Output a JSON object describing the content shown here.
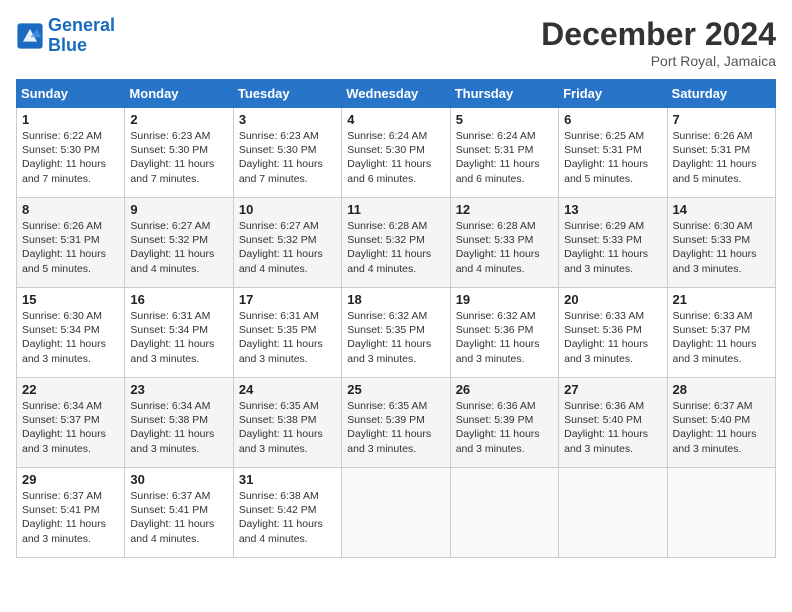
{
  "header": {
    "logo_general": "General",
    "logo_blue": "Blue",
    "month_title": "December 2024",
    "location": "Port Royal, Jamaica"
  },
  "weekdays": [
    "Sunday",
    "Monday",
    "Tuesday",
    "Wednesday",
    "Thursday",
    "Friday",
    "Saturday"
  ],
  "weeks": [
    [
      {
        "day": 1,
        "sunrise": "6:22 AM",
        "sunset": "5:30 PM",
        "daylight": "11 hours and 7 minutes."
      },
      {
        "day": 2,
        "sunrise": "6:23 AM",
        "sunset": "5:30 PM",
        "daylight": "11 hours and 7 minutes."
      },
      {
        "day": 3,
        "sunrise": "6:23 AM",
        "sunset": "5:30 PM",
        "daylight": "11 hours and 7 minutes."
      },
      {
        "day": 4,
        "sunrise": "6:24 AM",
        "sunset": "5:30 PM",
        "daylight": "11 hours and 6 minutes."
      },
      {
        "day": 5,
        "sunrise": "6:24 AM",
        "sunset": "5:31 PM",
        "daylight": "11 hours and 6 minutes."
      },
      {
        "day": 6,
        "sunrise": "6:25 AM",
        "sunset": "5:31 PM",
        "daylight": "11 hours and 5 minutes."
      },
      {
        "day": 7,
        "sunrise": "6:26 AM",
        "sunset": "5:31 PM",
        "daylight": "11 hours and 5 minutes."
      }
    ],
    [
      {
        "day": 8,
        "sunrise": "6:26 AM",
        "sunset": "5:31 PM",
        "daylight": "11 hours and 5 minutes."
      },
      {
        "day": 9,
        "sunrise": "6:27 AM",
        "sunset": "5:32 PM",
        "daylight": "11 hours and 4 minutes."
      },
      {
        "day": 10,
        "sunrise": "6:27 AM",
        "sunset": "5:32 PM",
        "daylight": "11 hours and 4 minutes."
      },
      {
        "day": 11,
        "sunrise": "6:28 AM",
        "sunset": "5:32 PM",
        "daylight": "11 hours and 4 minutes."
      },
      {
        "day": 12,
        "sunrise": "6:28 AM",
        "sunset": "5:33 PM",
        "daylight": "11 hours and 4 minutes."
      },
      {
        "day": 13,
        "sunrise": "6:29 AM",
        "sunset": "5:33 PM",
        "daylight": "11 hours and 3 minutes."
      },
      {
        "day": 14,
        "sunrise": "6:30 AM",
        "sunset": "5:33 PM",
        "daylight": "11 hours and 3 minutes."
      }
    ],
    [
      {
        "day": 15,
        "sunrise": "6:30 AM",
        "sunset": "5:34 PM",
        "daylight": "11 hours and 3 minutes."
      },
      {
        "day": 16,
        "sunrise": "6:31 AM",
        "sunset": "5:34 PM",
        "daylight": "11 hours and 3 minutes."
      },
      {
        "day": 17,
        "sunrise": "6:31 AM",
        "sunset": "5:35 PM",
        "daylight": "11 hours and 3 minutes."
      },
      {
        "day": 18,
        "sunrise": "6:32 AM",
        "sunset": "5:35 PM",
        "daylight": "11 hours and 3 minutes."
      },
      {
        "day": 19,
        "sunrise": "6:32 AM",
        "sunset": "5:36 PM",
        "daylight": "11 hours and 3 minutes."
      },
      {
        "day": 20,
        "sunrise": "6:33 AM",
        "sunset": "5:36 PM",
        "daylight": "11 hours and 3 minutes."
      },
      {
        "day": 21,
        "sunrise": "6:33 AM",
        "sunset": "5:37 PM",
        "daylight": "11 hours and 3 minutes."
      }
    ],
    [
      {
        "day": 22,
        "sunrise": "6:34 AM",
        "sunset": "5:37 PM",
        "daylight": "11 hours and 3 minutes."
      },
      {
        "day": 23,
        "sunrise": "6:34 AM",
        "sunset": "5:38 PM",
        "daylight": "11 hours and 3 minutes."
      },
      {
        "day": 24,
        "sunrise": "6:35 AM",
        "sunset": "5:38 PM",
        "daylight": "11 hours and 3 minutes."
      },
      {
        "day": 25,
        "sunrise": "6:35 AM",
        "sunset": "5:39 PM",
        "daylight": "11 hours and 3 minutes."
      },
      {
        "day": 26,
        "sunrise": "6:36 AM",
        "sunset": "5:39 PM",
        "daylight": "11 hours and 3 minutes."
      },
      {
        "day": 27,
        "sunrise": "6:36 AM",
        "sunset": "5:40 PM",
        "daylight": "11 hours and 3 minutes."
      },
      {
        "day": 28,
        "sunrise": "6:37 AM",
        "sunset": "5:40 PM",
        "daylight": "11 hours and 3 minutes."
      }
    ],
    [
      {
        "day": 29,
        "sunrise": "6:37 AM",
        "sunset": "5:41 PM",
        "daylight": "11 hours and 3 minutes."
      },
      {
        "day": 30,
        "sunrise": "6:37 AM",
        "sunset": "5:41 PM",
        "daylight": "11 hours and 4 minutes."
      },
      {
        "day": 31,
        "sunrise": "6:38 AM",
        "sunset": "5:42 PM",
        "daylight": "11 hours and 4 minutes."
      },
      null,
      null,
      null,
      null
    ]
  ]
}
